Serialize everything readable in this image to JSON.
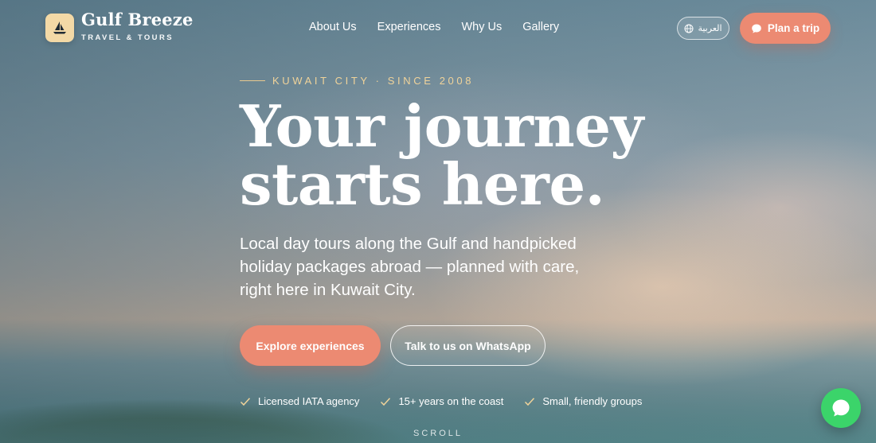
{
  "brand": {
    "name": "Gulf Breeze",
    "tagline": "TRAVEL & TOURS",
    "logo_icon": "sailboat-icon"
  },
  "nav": {
    "items": [
      {
        "label": "About Us"
      },
      {
        "label": "Experiences"
      },
      {
        "label": "Why Us"
      },
      {
        "label": "Gallery"
      }
    ]
  },
  "header_actions": {
    "language_label": "العربية",
    "language_icon": "globe-icon",
    "plan_label": "Plan a trip",
    "plan_icon": "chat-bubble-icon"
  },
  "hero": {
    "eyebrow": "KUWAIT CITY · SINCE 2008",
    "headline_line1": "Your journey",
    "headline_line2": "starts here.",
    "subcopy": "Local day tours along the Gulf and handpicked holiday packages abroad — planned with care, right here in Kuwait City.",
    "primary_cta": "Explore experiences",
    "secondary_cta": "Talk to us on WhatsApp",
    "badges": [
      {
        "label": "Licensed IATA agency"
      },
      {
        "label": "15+ years on the coast"
      },
      {
        "label": "Small, friendly groups"
      }
    ],
    "scroll_hint": "SCROLL"
  },
  "chat_fab": {
    "icon": "whatsapp-icon"
  },
  "colors": {
    "accent": "#ec8a72",
    "eyebrow": "#f0d39a",
    "logo_bg": "#f3d9a6",
    "whatsapp": "#3bd46a"
  }
}
